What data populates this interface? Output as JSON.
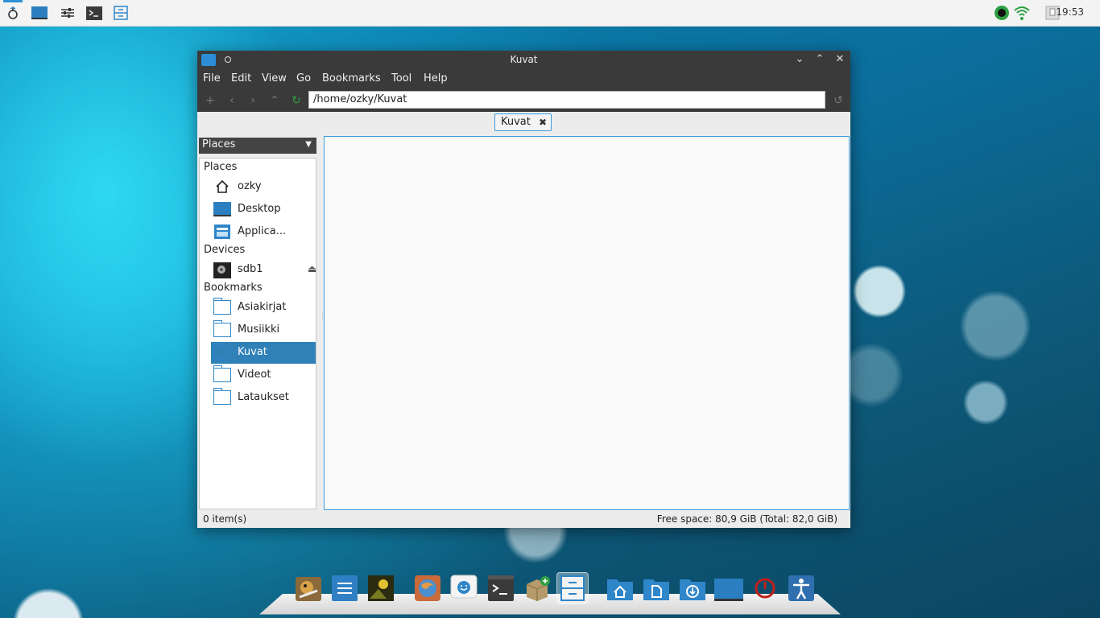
{
  "top_panel": {
    "clock": "19:53",
    "launchers": [
      {
        "name": "menu-icon"
      },
      {
        "name": "show-desktop-icon"
      },
      {
        "name": "settings-sliders-icon"
      },
      {
        "name": "terminal-icon"
      },
      {
        "name": "file-manager-icon"
      }
    ],
    "tray": [
      "network-status-icon",
      "wifi-icon",
      "clipboard-icon"
    ]
  },
  "window": {
    "title": "Kuvat",
    "menu": [
      "File",
      "Edit",
      "View",
      "Go",
      "Bookmarks",
      "Tool",
      "Help"
    ],
    "path": "/home/ozky/Kuvat",
    "tab_label": "Kuvat",
    "places_dropdown": "Places",
    "sidebar": {
      "places_heading": "Places",
      "places": [
        "ozky",
        "Desktop",
        "Applica..."
      ],
      "devices_heading": "Devices",
      "devices": [
        "sdb1"
      ],
      "bookmarks_heading": "Bookmarks",
      "bookmarks": [
        "Asiakirjat",
        "Musiikki",
        "Kuvat",
        "Videot",
        "Lataukset"
      ],
      "selected": "Kuvat"
    },
    "status_left": "0 item(s)",
    "status_right": "Free space: 80,9 GiB (Total: 82,0 GiB)"
  },
  "colors": {
    "accent": "#2f86c9",
    "selection": "#2f81b8",
    "titlebar": "#3a3a3a"
  },
  "dock": [
    "gimp-icon",
    "text-editor-icon",
    "image-viewer-icon",
    "browser-icon",
    "chat-icon",
    "terminal-icon",
    "package-installer-icon",
    "file-manager-icon",
    "home-folder-icon",
    "documents-folder-icon",
    "downloads-folder-icon",
    "desktop-icon",
    "power-icon",
    "accessibility-icon"
  ]
}
